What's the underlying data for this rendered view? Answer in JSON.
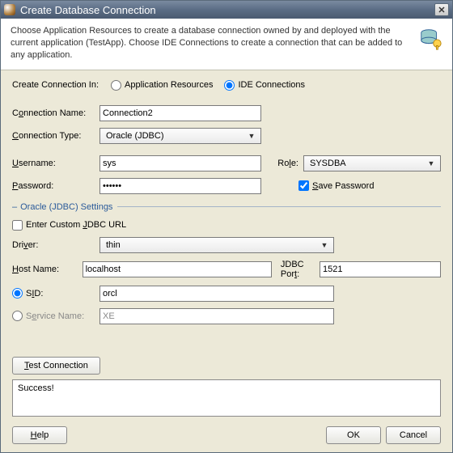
{
  "window": {
    "title": "Create Database Connection"
  },
  "header": {
    "description": "Choose Application Resources to create a database connection owned by and deployed with the current application (TestApp). Choose IDE Connections to create a connection that can be added to any application."
  },
  "createIn": {
    "label": "Create Connection In:",
    "optionA": "Application Resources",
    "optionB": "IDE Connections",
    "selected": "IDE Connections"
  },
  "connName": {
    "label_pre": "C",
    "label_u": "o",
    "label_post": "nnection Name:",
    "value": "Connection2"
  },
  "connType": {
    "label_u": "C",
    "label_post": "onnection Type:",
    "value": "Oracle (JDBC)"
  },
  "username": {
    "label_u": "U",
    "label_post": "sername:",
    "value": "sys"
  },
  "role": {
    "label_pre": "Ro",
    "label_u": "l",
    "label_post": "e:",
    "value": "SYSDBA"
  },
  "password": {
    "label_u": "P",
    "label_post": "assword:",
    "value": "••••••"
  },
  "savepw": {
    "label_u": "S",
    "label_post": "ave Password",
    "checked": true
  },
  "section": {
    "title": "Oracle (JDBC) Settings"
  },
  "jdbcurl": {
    "label_pre": "Enter Custom ",
    "label_u": "J",
    "label_post": "DBC URL",
    "checked": false
  },
  "driver": {
    "label_pre": "Dri",
    "label_u": "v",
    "label_post": "er:",
    "value": "thin"
  },
  "host": {
    "label_u": "H",
    "label_post": "ost Name:",
    "value": "localhost"
  },
  "port": {
    "label_pre": "JDBC Por",
    "label_u": "t",
    "label_post": ":",
    "value": "1521"
  },
  "sid": {
    "label_pre": "S",
    "label_u": "I",
    "label_post": "D:",
    "value": "orcl",
    "selected": true
  },
  "service": {
    "label_pre": "S",
    "label_u": "e",
    "label_post": "rvice Name:",
    "value": "XE",
    "selected": false
  },
  "test": {
    "label_u": "T",
    "label_post": "est Connection"
  },
  "result": {
    "text": "Success!"
  },
  "buttons": {
    "help": "Help",
    "ok": "OK",
    "cancel": "Cancel"
  }
}
